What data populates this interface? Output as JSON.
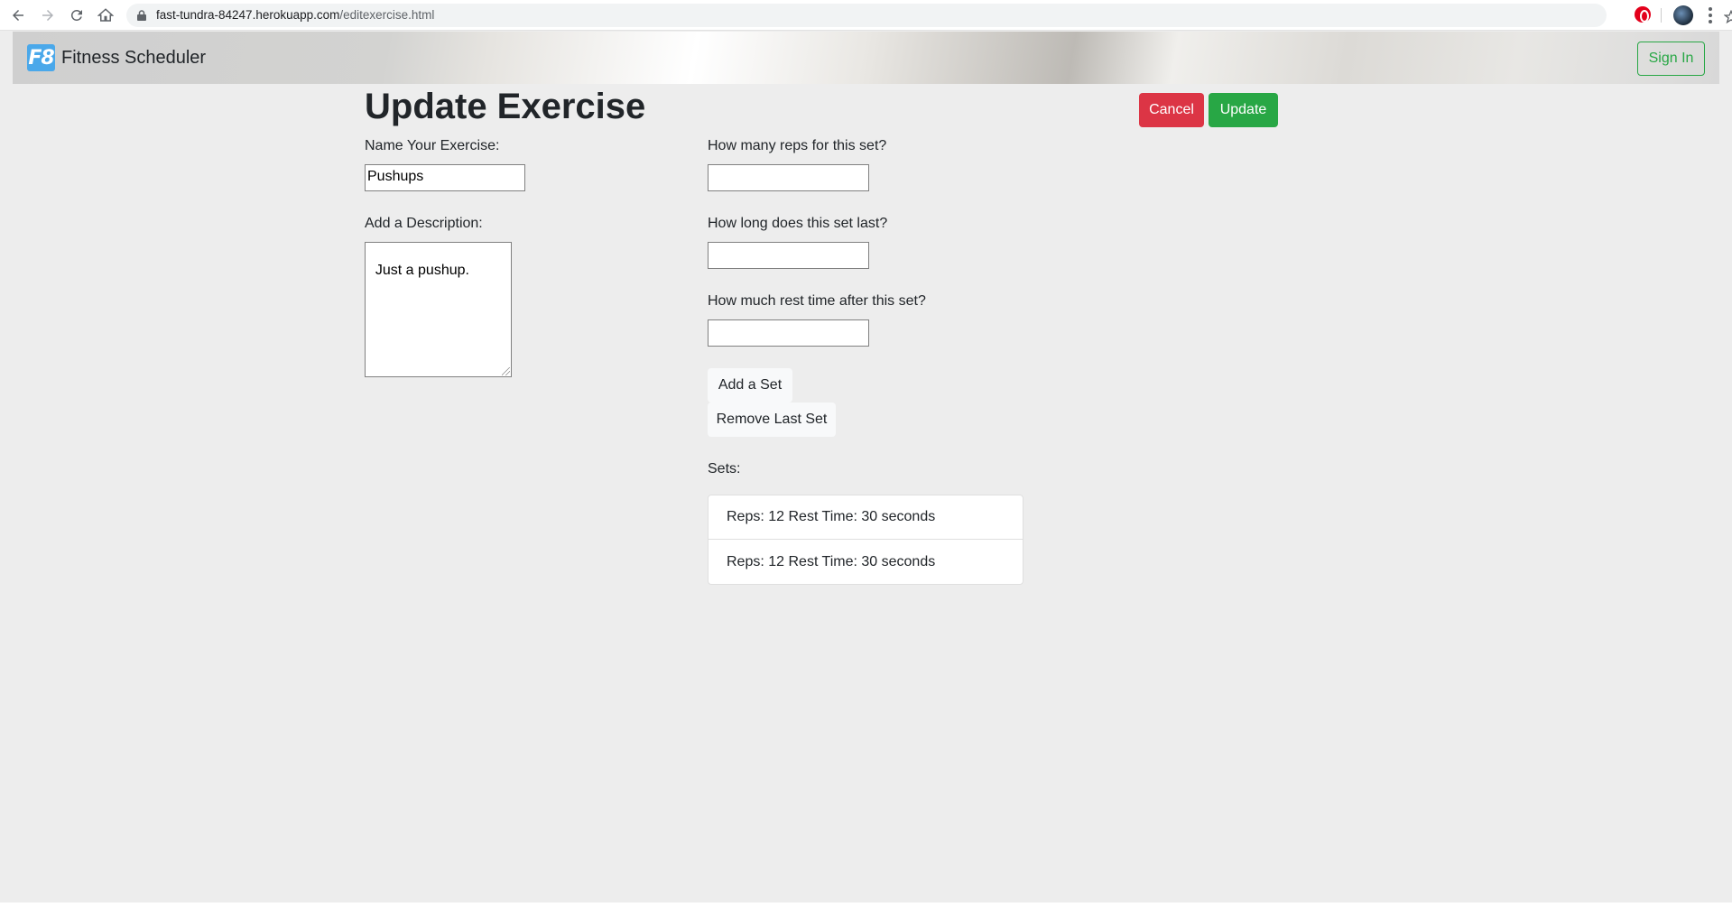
{
  "browser": {
    "url_host": "fast-tundra-84247.herokuapp.com",
    "url_path": "/editexercise.html"
  },
  "navbar": {
    "logo_text": "F8",
    "brand": "Fitness Scheduler",
    "signin_label": "Sign In"
  },
  "page": {
    "title": "Update Exercise",
    "cancel_label": "Cancel",
    "update_label": "Update"
  },
  "form": {
    "name_label": "Name Your Exercise:",
    "name_value": "Pushups",
    "description_label": "Add a Description:",
    "description_value": "Just a pushup.",
    "reps_label": "How many reps for this set?",
    "reps_value": "",
    "duration_label": "How long does this set last?",
    "duration_value": "",
    "rest_label": "How much rest time after this set?",
    "rest_value": "",
    "add_set_label": "Add a Set",
    "remove_set_label": "Remove Last Set",
    "sets_label": "Sets:"
  },
  "sets": [
    "Reps: 12 Rest Time: 30 seconds",
    "Reps: 12 Rest Time: 30 seconds"
  ],
  "colors": {
    "cancel": "#dc3545",
    "update": "#28a745",
    "logo": "#4aa8ea"
  }
}
